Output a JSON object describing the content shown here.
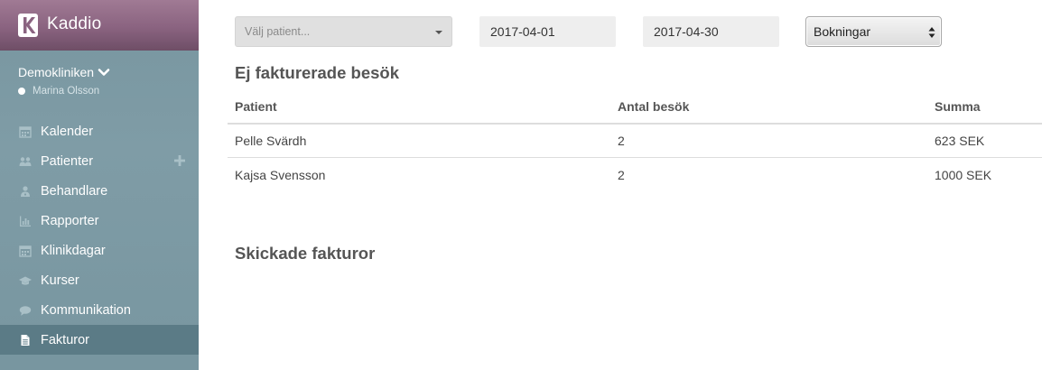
{
  "brand": {
    "name": "Kaddio"
  },
  "clinic": {
    "name": "Demokliniken",
    "user": "Marina Olsson"
  },
  "nav": {
    "items": [
      {
        "label": "Kalender",
        "icon": "calendar-icon"
      },
      {
        "label": "Patienter",
        "icon": "users-icon"
      },
      {
        "label": "Behandlare",
        "icon": "user-md-icon"
      },
      {
        "label": "Rapporter",
        "icon": "bar-chart-icon"
      },
      {
        "label": "Klinikdagar",
        "icon": "calendar-icon"
      },
      {
        "label": "Kurser",
        "icon": "graduation-cap-icon"
      },
      {
        "label": "Kommunikation",
        "icon": "comment-icon"
      },
      {
        "label": "Fakturor",
        "icon": "file-icon"
      }
    ],
    "active": "Fakturor"
  },
  "filters": {
    "patient_placeholder": "Välj patient...",
    "from_date": "2017-04-01",
    "to_date": "2017-04-30",
    "type": "Bokningar"
  },
  "unbilled": {
    "title": "Ej fakturerade besök",
    "headers": [
      "Patient",
      "Antal besök",
      "Summa"
    ],
    "rows": [
      [
        "Pelle Svärdh",
        "2",
        "623 SEK"
      ],
      [
        "Kajsa Svensson",
        "2",
        "1000 SEK"
      ]
    ]
  },
  "sent": {
    "title": "Skickade fakturor"
  },
  "colors": {
    "sidebar": "#7896a0",
    "brand_bar": "#8a6380",
    "active_item": "#5b7b86"
  }
}
